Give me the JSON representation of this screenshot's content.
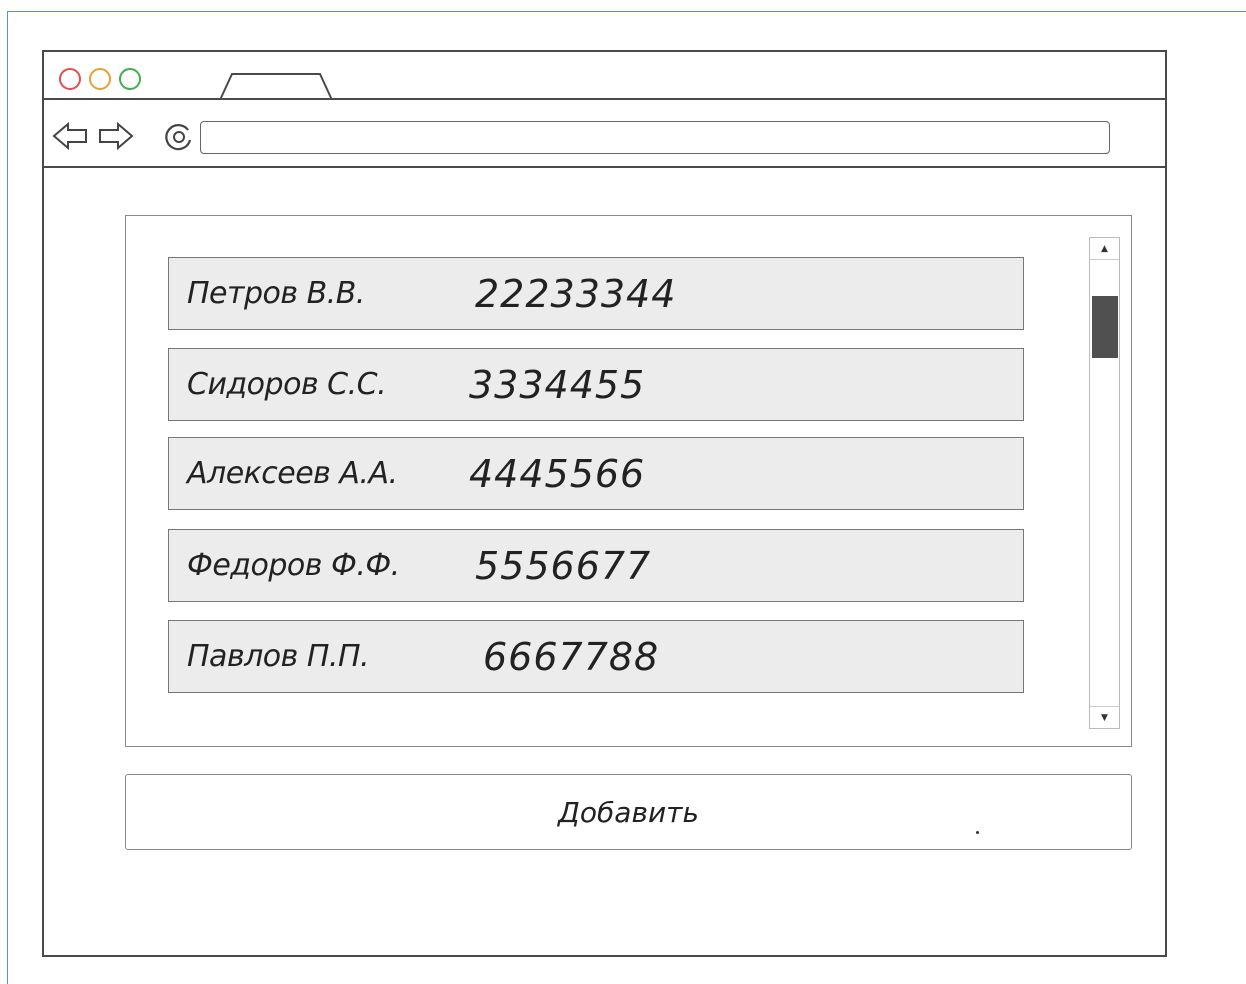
{
  "window": {
    "controls": [
      "close",
      "minimize",
      "maximize"
    ],
    "nav": {
      "back_icon": "back-arrow-icon",
      "forward_icon": "forward-arrow-icon",
      "reload_icon": "reload-icon",
      "url_value": ""
    }
  },
  "contacts": {
    "rows": [
      {
        "name": "Петров В.В.",
        "phone": "22233344"
      },
      {
        "name": "Сидоров С.С.",
        "phone": "3334455"
      },
      {
        "name": "Алексеев А.А.",
        "phone": "4445566"
      },
      {
        "name": "Федоров Ф.Ф.",
        "phone": "5556677"
      },
      {
        "name": "Павлов П.П.",
        "phone": "6667788"
      }
    ]
  },
  "scrollbar": {
    "up_icon": "scroll-up-icon",
    "down_icon": "scroll-down-icon",
    "position": 0.0
  },
  "actions": {
    "add_label": "Добавить"
  },
  "colors": {
    "close": "#e05050",
    "minimize": "#e8a030",
    "maximize": "#3fb04a",
    "row_bg": "#ececec",
    "thumb": "#505050"
  }
}
